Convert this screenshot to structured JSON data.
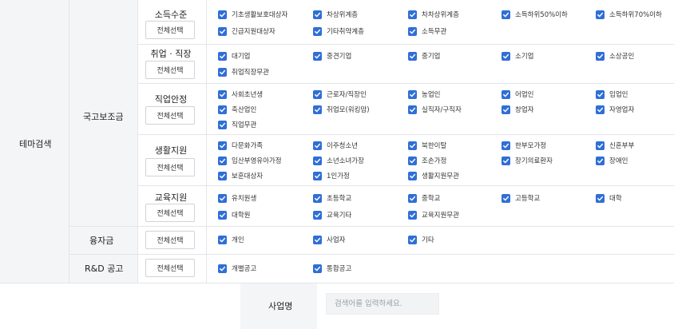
{
  "theme_label": "테마검색",
  "groups": [
    {
      "name": "국고보조금"
    },
    {
      "name": "융자금"
    },
    {
      "name": "R&D 공고"
    }
  ],
  "select_all_label": "전체선택",
  "categories": [
    {
      "label": "소득수준",
      "options": [
        "기초생활보호대상자",
        "차상위계층",
        "차차상위계층",
        "소득하위50%이하",
        "소득하위70%이하",
        "긴급지원대상자",
        "기타취약계층",
        "소득무관"
      ]
    },
    {
      "label": "취업 · 직장",
      "options": [
        "대기업",
        "중견기업",
        "중기업",
        "소기업",
        "소상공인",
        "취업직장무관"
      ]
    },
    {
      "label": "직업안정",
      "options": [
        "사회초년생",
        "근로자/직장인",
        "농업인",
        "어업인",
        "임업인",
        "축산업인",
        "취업모(워킹맘)",
        "실직자/구직자",
        "창업자",
        "자영업자",
        "직업무관"
      ]
    },
    {
      "label": "생활지원",
      "options": [
        "다문화가족",
        "이주청소년",
        "북한이탈",
        "한부모가정",
        "신혼부부",
        "임산부영유아가정",
        "소년소녀가장",
        "조손가정",
        "장기의료환자",
        "장애인",
        "보훈대상자",
        "1인가정",
        "생활지원무관"
      ]
    },
    {
      "label": "교육지원",
      "options": [
        "유치원생",
        "초등학교",
        "중학교",
        "고등학교",
        "대학",
        "대학원",
        "교육기타",
        "교육지원무관"
      ]
    },
    {
      "label": "융자금",
      "options": [
        "개인",
        "사업자",
        "기타"
      ]
    },
    {
      "label": "R&D 공고",
      "options": [
        "개별공고",
        "통합공고"
      ]
    }
  ],
  "business_name_label": "사업명",
  "search": {
    "placeholder": "검색어를 입력하세요."
  },
  "colors": {
    "checkbox": "#2f6fd6",
    "label_bg": "#f4f5f7",
    "border": "#e3e5e8"
  }
}
